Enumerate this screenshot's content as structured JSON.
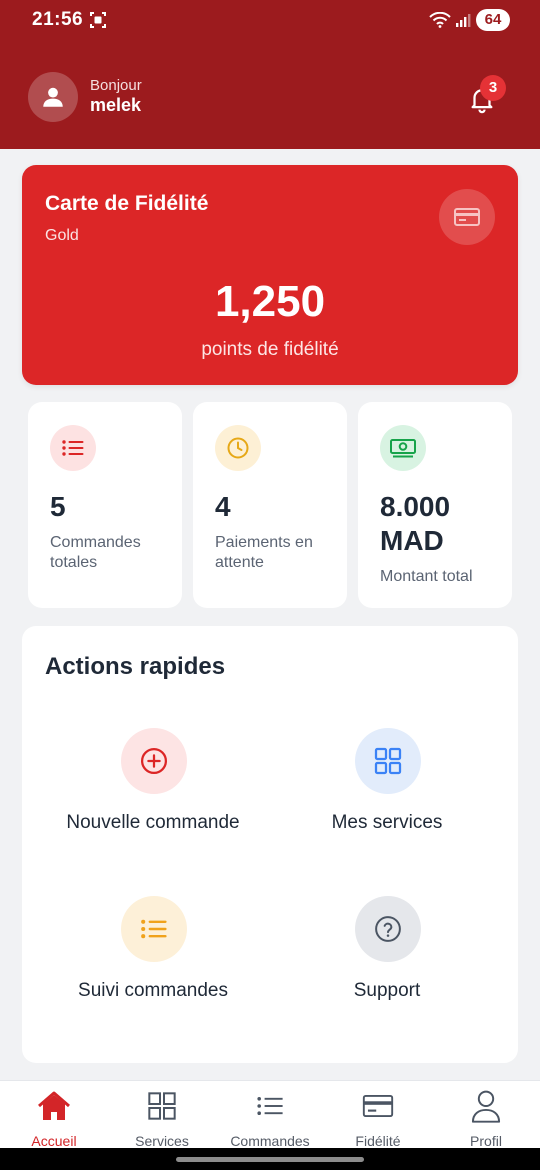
{
  "status_bar": {
    "time": "21:56",
    "battery": "64"
  },
  "header": {
    "greeting": "Bonjour",
    "username": "melek",
    "notification_count": "3"
  },
  "loyalty_card": {
    "title": "Carte de Fidélité",
    "tier": "Gold",
    "points": "1,250",
    "points_label": "points de fidélité",
    "icon": "credit-card-icon"
  },
  "stats": [
    {
      "value": "5",
      "label": "Commandes totales",
      "icon": "list-icon",
      "color": "#dc2626"
    },
    {
      "value": "4",
      "label": "Paiements en attente",
      "icon": "clock-icon",
      "color": "#e6a817"
    },
    {
      "value": "8.000 MAD",
      "label": "Montant total",
      "icon": "money-icon",
      "color": "#16a34a"
    }
  ],
  "quick_actions": {
    "title": "Actions rapides",
    "items": [
      {
        "label": "Nouvelle commande",
        "icon": "plus-circle-icon",
        "color": "#dc2626"
      },
      {
        "label": "Mes services",
        "icon": "grid-icon",
        "color": "#3b82f6"
      },
      {
        "label": "Suivi commandes",
        "icon": "list-icon",
        "color": "#f0a21b"
      },
      {
        "label": "Support",
        "icon": "help-circle-icon",
        "color": "#6b7280"
      }
    ]
  },
  "bottom_nav": {
    "items": [
      {
        "label": "Accueil",
        "icon": "home-icon",
        "active": true
      },
      {
        "label": "Services",
        "icon": "grid-icon",
        "active": false
      },
      {
        "label": "Commandes",
        "icon": "list-icon",
        "active": false
      },
      {
        "label": "Fidélité",
        "icon": "credit-card-icon",
        "active": false
      },
      {
        "label": "Profil",
        "icon": "user-icon",
        "active": false
      }
    ]
  },
  "colors": {
    "header": "#9c1b1e",
    "card": "#dc2627",
    "accent": "#d32528",
    "background": "#f1f2f4"
  }
}
